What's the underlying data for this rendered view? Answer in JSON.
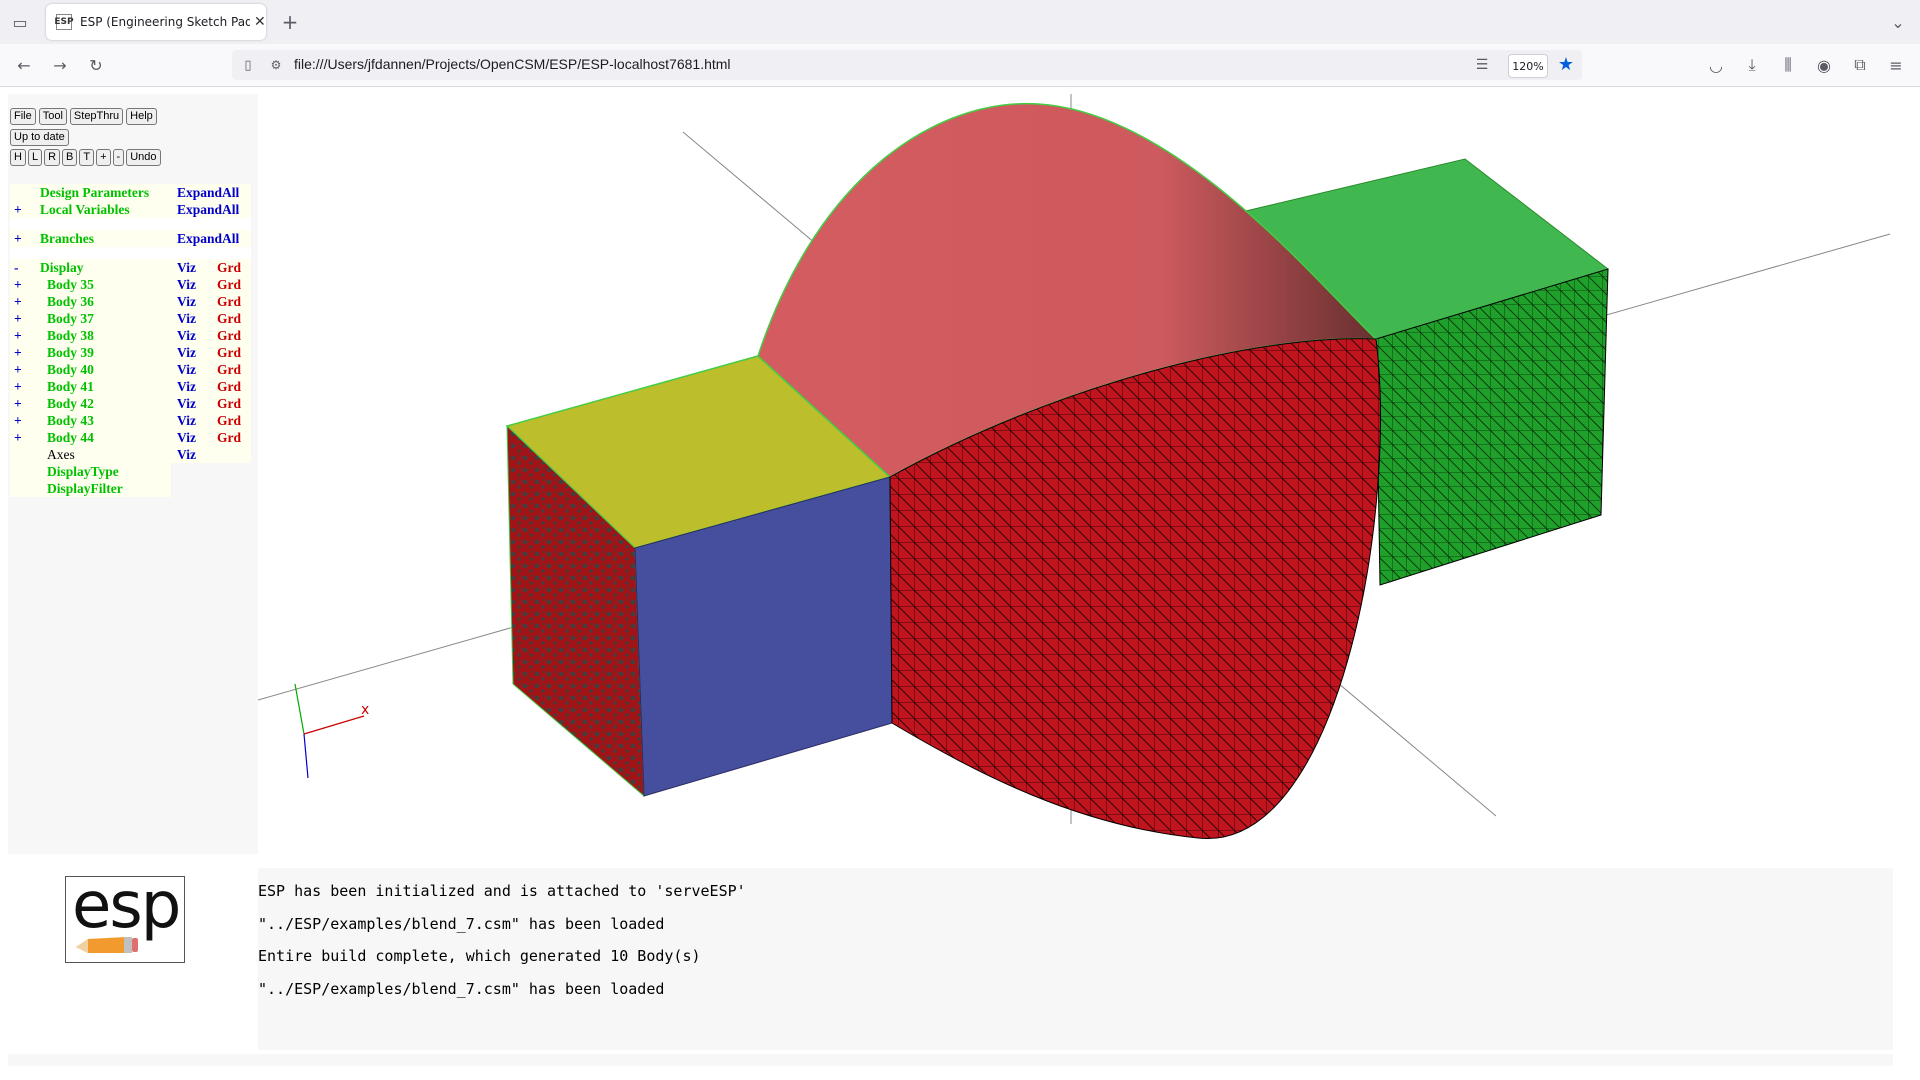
{
  "browser": {
    "tab_title": "ESP (Engineering Sketch Pad, V",
    "tab_favicon": "ESP",
    "url": "file:///Users/jfdannen/Projects/OpenCSM/ESP/ESP-localhost7681.html",
    "zoom": "120%"
  },
  "toolbar": {
    "row1": [
      "File",
      "Tool",
      "StepThru",
      "Help"
    ],
    "status": "Up to date",
    "row3": [
      "H",
      "L",
      "R",
      "B",
      "T",
      "+",
      "-",
      "Undo"
    ]
  },
  "tree": {
    "design_params": {
      "pm": "",
      "label": "Design Parameters",
      "action": "ExpandAll"
    },
    "local_vars": {
      "pm": "+",
      "label": "Local Variables",
      "action": "ExpandAll"
    },
    "branches": {
      "pm": "+",
      "label": "Branches",
      "action": "ExpandAll"
    },
    "display": {
      "pm": "-",
      "label": "Display",
      "viz": "Viz",
      "grd": "Grd"
    },
    "bodies": [
      {
        "pm": "+",
        "label": "Body 35",
        "viz": "Viz",
        "grd": "Grd"
      },
      {
        "pm": "+",
        "label": "Body 36",
        "viz": "Viz",
        "grd": "Grd"
      },
      {
        "pm": "+",
        "label": "Body 37",
        "viz": "Viz",
        "grd": "Grd"
      },
      {
        "pm": "+",
        "label": "Body 38",
        "viz": "Viz",
        "grd": "Grd"
      },
      {
        "pm": "+",
        "label": "Body 39",
        "viz": "Viz",
        "grd": "Grd"
      },
      {
        "pm": "+",
        "label": "Body 40",
        "viz": "Viz",
        "grd": "Grd"
      },
      {
        "pm": "+",
        "label": "Body 41",
        "viz": "Viz",
        "grd": "Grd"
      },
      {
        "pm": "+",
        "label": "Body 42",
        "viz": "Viz",
        "grd": "Grd"
      },
      {
        "pm": "+",
        "label": "Body 43",
        "viz": "Viz",
        "grd": "Grd"
      },
      {
        "pm": "+",
        "label": "Body 44",
        "viz": "Viz",
        "grd": "Grd"
      }
    ],
    "axes": {
      "label": "Axes",
      "viz": "Viz"
    },
    "display_type": "DisplayType",
    "display_filter": "DisplayFilter"
  },
  "logo_text": "esp",
  "axis_label": "x",
  "messages": [
    "ESP has been initialized and is attached to 'serveESP'",
    "\"../ESP/examples/blend_7.csm\" has been loaded",
    "Entire build complete, which generated 10 Body(s)",
    "\"../ESP/examples/blend_7.csm\" has been loaded"
  ],
  "colors": {
    "tree_label": "#00c000",
    "tree_viz": "#0000cc",
    "tree_grd": "#cc0000",
    "yellow_face": "#bcbe2c",
    "blue_face": "#464e9e",
    "pink_face": "#cf5a5e",
    "red_face": "#c0141e",
    "green_face": "#41b84f"
  }
}
